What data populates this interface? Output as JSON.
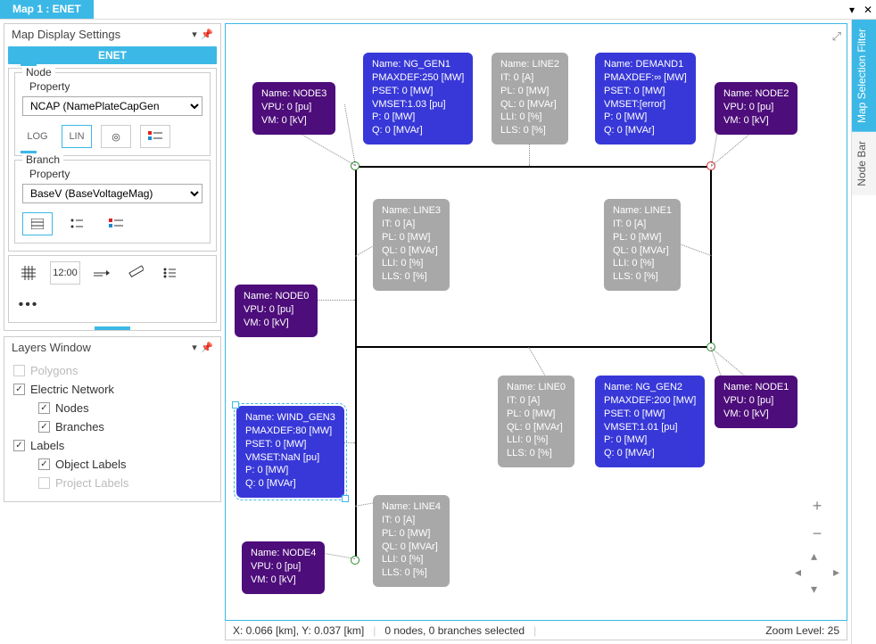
{
  "window": {
    "title": "Map 1 : ENET"
  },
  "sidebar": {
    "settings_title": "Map Display Settings",
    "enet_label": "ENET",
    "node": {
      "legend": "Node",
      "prop_label": "Property",
      "select": "NCAP (NamePlateCapGen",
      "log": "LOG",
      "lin": "LIN"
    },
    "branch": {
      "legend": "Branch",
      "prop_label": "Property",
      "select": "BaseV (BaseVoltageMag)"
    },
    "tool_time": "12:00",
    "layers_title": "Layers Window",
    "layers": {
      "polygons": "Polygons",
      "electric": "Electric Network",
      "nodes": "Nodes",
      "branches": "Branches",
      "labels": "Labels",
      "object_labels": "Object Labels",
      "project_labels": "Project Labels"
    }
  },
  "status": {
    "coords": "X: 0.066 [km], Y: 0.037 [km]",
    "sel": "0 nodes, 0 branches selected",
    "zoom": "Zoom Level: 25"
  },
  "right": {
    "filter": "Map Selection Filter",
    "nodebar": "Node Bar"
  },
  "labels": {
    "node3": "Name: NODE3\nVPU: 0 [pu]\nVM: 0 [kV]",
    "ng_gen1": "Name: NG_GEN1\nPMAXDEF:250 [MW]\nPSET: 0 [MW]\nVMSET:1.03 [pu]\nP: 0 [MW]\nQ: 0 [MVAr]",
    "line2": "Name: LINE2\nIT: 0 [A]\nPL: 0 [MW]\nQL: 0 [MVAr]\nLLI: 0 [%]\nLLS: 0 [%]",
    "demand1": "Name: DEMAND1\nPMAXDEF:∞ [MW]\nPSET: 0 [MW]\nVMSET:[error]\nP: 0 [MW]\nQ: 0 [MVAr]",
    "node2": "Name: NODE2\nVPU: 0 [pu]\nVM: 0 [kV]",
    "line3": "Name: LINE3\nIT: 0 [A]\nPL: 0 [MW]\nQL: 0 [MVAr]\nLLI: 0 [%]\nLLS: 0 [%]",
    "line1": "Name: LINE1\nIT: 0 [A]\nPL: 0 [MW]\nQL: 0 [MVAr]\nLLI: 0 [%]\nLLS: 0 [%]",
    "node0": "Name: NODE0\nVPU: 0 [pu]\nVM: 0 [kV]",
    "line0": "Name: LINE0\nIT: 0 [A]\nPL: 0 [MW]\nQL: 0 [MVAr]\nLLI: 0 [%]\nLLS: 0 [%]",
    "ng_gen2": "Name: NG_GEN2\nPMAXDEF:200 [MW]\nPSET: 0 [MW]\nVMSET:1.01 [pu]\nP: 0 [MW]\nQ: 0 [MVAr]",
    "node1": "Name: NODE1\nVPU: 0 [pu]\nVM: 0 [kV]",
    "wind_gen3": "Name: WIND_GEN3\nPMAXDEF:80 [MW]\nPSET: 0 [MW]\nVMSET:NaN [pu]\nP: 0 [MW]\nQ: 0 [MVAr]",
    "line4": "Name: LINE4\nIT: 0 [A]\nPL: 0 [MW]\nQL: 0 [MVAr]\nLLI: 0 [%]\nLLS: 0 [%]",
    "node4": "Name: NODE4\nVPU: 0 [pu]\nVM: 0 [kV]"
  }
}
